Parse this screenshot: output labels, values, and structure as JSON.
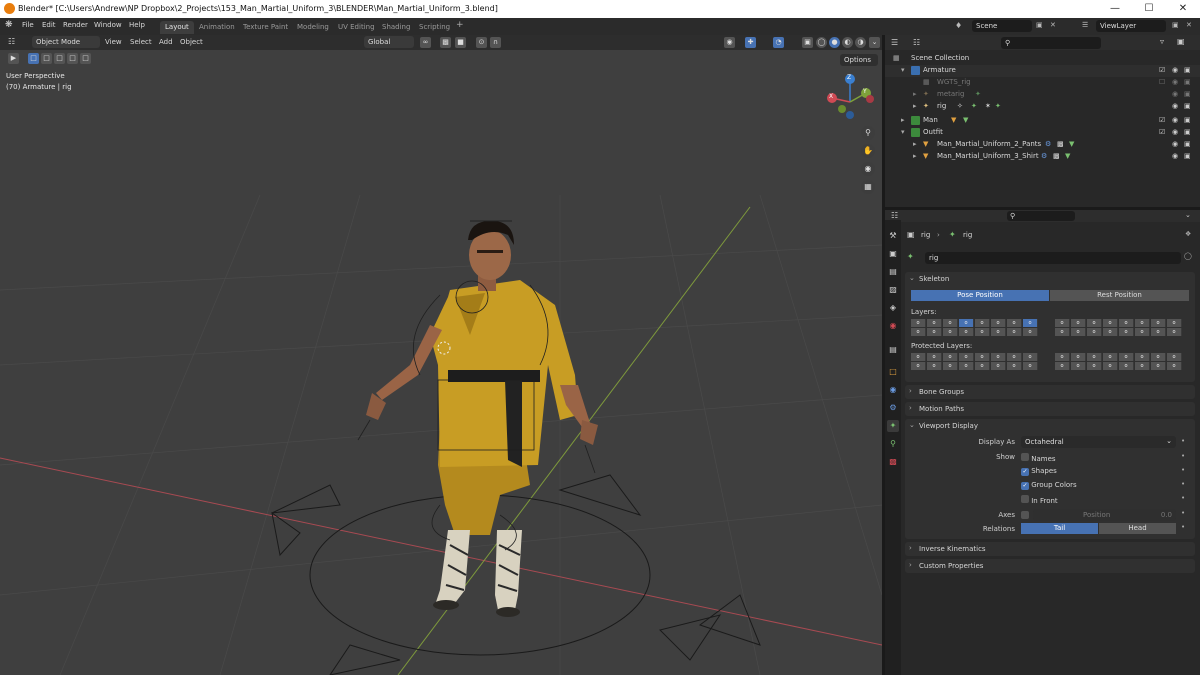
{
  "titlebar": {
    "title": "Blender* [C:\\Users\\Andrew\\NP Dropbox\\2_Projects\\153_Man_Martial_Uniform_3\\BLENDER\\Man_Martial_Uniform_3.blend]"
  },
  "menu": {
    "items": [
      "File",
      "Edit",
      "Render",
      "Window",
      "Help"
    ]
  },
  "workspaces": [
    "Layout",
    "Animation",
    "Texture Paint",
    "Modeling",
    "UV Editing",
    "Shading",
    "Scripting"
  ],
  "scene": {
    "scene_name": "Scene",
    "view_layer": "ViewLayer"
  },
  "viewport": {
    "mode": "Object Mode",
    "menus": [
      "View",
      "Select",
      "Add",
      "Object"
    ],
    "orientation": "Global",
    "overlay_title": "User Perspective",
    "overlay_sub": "(70) Armature | rig",
    "options_label": "Options",
    "gizmo": {
      "x": "X",
      "y": "Y",
      "z": "Z"
    }
  },
  "outliner": {
    "root": "Scene Collection",
    "rows": [
      {
        "label": "Armature",
        "indent": 1,
        "icon": "collection-icon",
        "dim": false
      },
      {
        "label": "WGTS_rig",
        "indent": 2,
        "icon": "collection-icon",
        "dim": true
      },
      {
        "label": "metarig",
        "indent": 2,
        "icon": "armature-icon",
        "dim": true
      },
      {
        "label": "rig",
        "indent": 2,
        "icon": "armature-icon",
        "dim": false
      },
      {
        "label": "Man",
        "indent": 1,
        "icon": "collection-icon",
        "dim": false
      },
      {
        "label": "Outfit",
        "indent": 1,
        "icon": "collection-icon",
        "dim": false
      },
      {
        "label": "Man_Martial_Uniform_2_Pants",
        "indent": 2,
        "icon": "mesh-icon",
        "dim": false
      },
      {
        "label": "Man_Martial_Uniform_3_Shirt",
        "indent": 2,
        "icon": "mesh-icon",
        "dim": false
      }
    ]
  },
  "properties": {
    "breadcrumb": [
      "rig",
      "rig"
    ],
    "data_name": "rig",
    "skeleton": {
      "header": "Skeleton",
      "pose_position": "Pose Position",
      "rest_position": "Rest Position",
      "layers_label": "Layers:",
      "protected_label": "Protected Layers:"
    },
    "bone_groups": "Bone Groups",
    "motion_paths": "Motion Paths",
    "viewport_display": {
      "header": "Viewport Display",
      "display_as_label": "Display As",
      "display_as_value": "Octahedral",
      "show_label": "Show",
      "names": "Names",
      "shapes": "Shapes",
      "group_colors": "Group Colors",
      "in_front": "In Front",
      "axes_label": "Axes",
      "position_label": "Position",
      "position_value": "0.0",
      "relations_label": "Relations",
      "tail": "Tail",
      "head": "Head"
    },
    "inverse_kinematics": "Inverse Kinematics",
    "custom_properties": "Custom Properties"
  },
  "colors": {
    "accent": "#4772b3",
    "viewport_bg": "#3f3f3f",
    "panel": "#303030",
    "header": "#2b2b2b"
  }
}
